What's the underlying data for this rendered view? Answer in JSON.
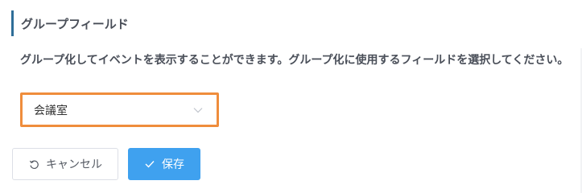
{
  "section": {
    "title": "グループフィールド",
    "description": "グループ化してイベントを表示することができます。グループ化に使用するフィールドを選択してください。"
  },
  "group_field_select": {
    "selected_value": "会議室",
    "icon": "chevron-down-icon"
  },
  "buttons": {
    "cancel_label": "キャンセル",
    "cancel_icon": "undo-icon",
    "save_label": "保存",
    "save_icon": "check-icon"
  },
  "colors": {
    "title_accent": "#2f6e98",
    "select_highlight": "#ef8d3c",
    "primary": "#3fa1ef"
  }
}
